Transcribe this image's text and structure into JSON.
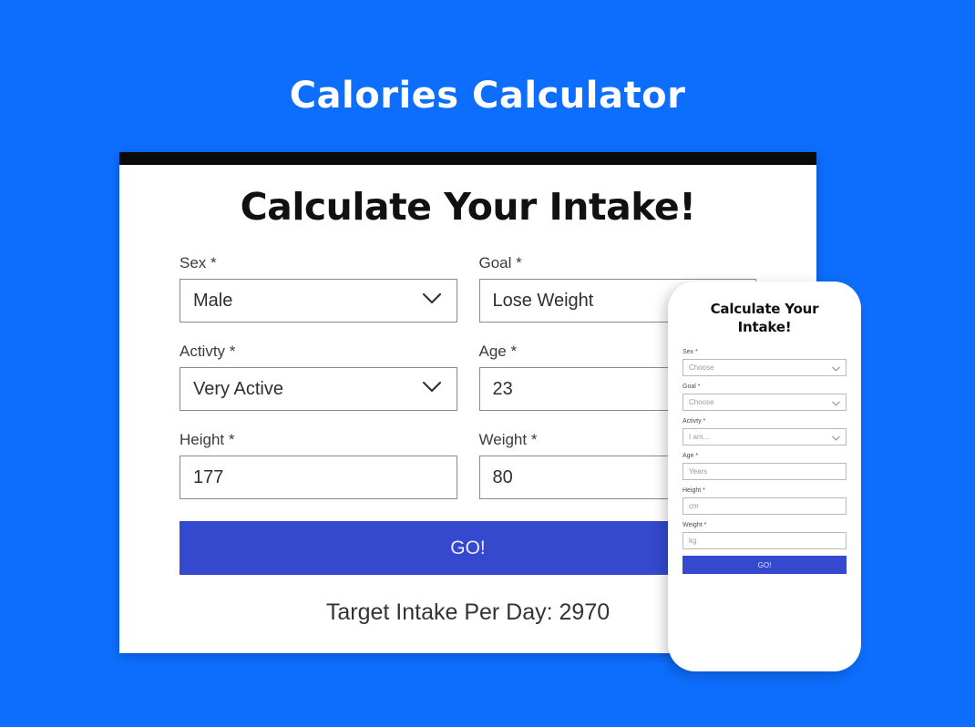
{
  "page": {
    "title": "Calories Calculator",
    "background_color": "#0d6efd",
    "accent_button_color": "#3449ce"
  },
  "desktop_card": {
    "heading": "Calculate Your Intake!",
    "fields": [
      {
        "label": "Sex *",
        "value": "Male",
        "type": "select",
        "icon": "chevron-down-icon",
        "name": "sex"
      },
      {
        "label": "Goal *",
        "value": "Lose Weight",
        "type": "select",
        "icon": "chevron-down-icon",
        "name": "goal"
      },
      {
        "label": "Activty *",
        "value": "Very Active",
        "type": "select",
        "icon": "chevron-down-icon",
        "name": "activity"
      },
      {
        "label": "Age *",
        "value": "23",
        "type": "text",
        "icon": "",
        "name": "age"
      },
      {
        "label": "Height *",
        "value": "177",
        "type": "text",
        "icon": "",
        "name": "height"
      },
      {
        "label": "Weight *",
        "value": "80",
        "type": "text",
        "icon": "",
        "name": "weight"
      }
    ],
    "submit_label": "GO!",
    "result_text": "Target Intake Per Day: 2970"
  },
  "mobile_card": {
    "heading": "Calculate Your Intake!",
    "fields": [
      {
        "label": "Sex *",
        "value": "Choose",
        "type": "select",
        "icon": "chevron-down-icon",
        "name": "sex"
      },
      {
        "label": "Goal *",
        "value": "Choose",
        "type": "select",
        "icon": "chevron-down-icon",
        "name": "goal"
      },
      {
        "label": "Activty *",
        "value": "I am...",
        "type": "select",
        "icon": "chevron-down-icon",
        "name": "activity"
      },
      {
        "label": "Age *",
        "value": "Years",
        "type": "text",
        "icon": "",
        "name": "age"
      },
      {
        "label": "Height *",
        "value": "cm",
        "type": "text",
        "icon": "",
        "name": "height"
      },
      {
        "label": "Weight *",
        "value": "kg",
        "type": "text",
        "icon": "",
        "name": "weight"
      }
    ],
    "submit_label": "GO!"
  }
}
